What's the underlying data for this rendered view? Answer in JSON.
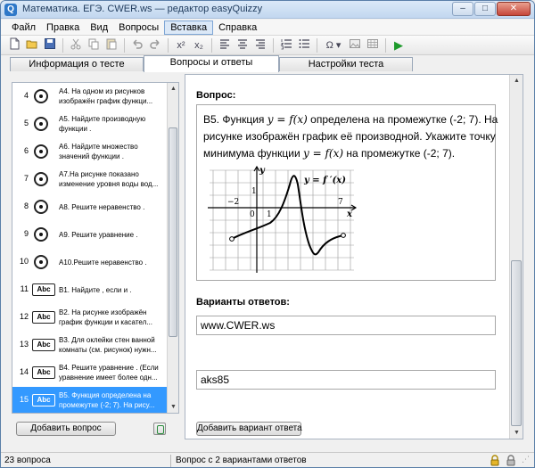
{
  "window": {
    "title": "Математика. ЕГЭ. CWER.ws — редактор easyQuizzy",
    "app_icon": "Q",
    "minimize": "–",
    "maximize": "□",
    "close": "✕"
  },
  "menu": [
    "Файл",
    "Правка",
    "Вид",
    "Вопросы",
    "Вставка",
    "Справка"
  ],
  "toolbar": {
    "icons": [
      "new-file-icon",
      "open-folder-icon",
      "save-icon",
      "cut-icon",
      "copy-icon",
      "paste-icon",
      "undo-icon",
      "redo-icon",
      "superscript-icon",
      "subscript-icon",
      "align-left-icon",
      "align-center-icon",
      "align-right-icon",
      "numbered-list-icon",
      "bullet-list-icon",
      "omega-symbol-icon",
      "image-icon",
      "table-icon",
      "play-icon"
    ],
    "superscript": "x²",
    "subscript": "x₂",
    "omega": "Ω ▾",
    "play": "▶"
  },
  "tabs": [
    "Информация о тесте",
    "Вопросы и ответы",
    "Настройки теста"
  ],
  "questions": [
    {
      "num": "4",
      "type": "radio",
      "text": "А4. На одном из рисунков\nизображён график функци..."
    },
    {
      "num": "5",
      "type": "radio",
      "text": "А5. Найдите производную\nфункции ."
    },
    {
      "num": "6",
      "type": "radio",
      "text": "А6. Найдите множество\nзначений функции ."
    },
    {
      "num": "7",
      "type": "radio",
      "text": "А7.На рисунке показано\nизменение уровня воды вод..."
    },
    {
      "num": "8",
      "type": "radio",
      "text": "А8. Решите неравенство ."
    },
    {
      "num": "9",
      "type": "radio",
      "text": "А9. Решите уравнение ."
    },
    {
      "num": "10",
      "type": "radio",
      "text": "А10.Решите неравенство ."
    },
    {
      "num": "11",
      "type": "abc",
      "text": "В1. Найдите , если и ."
    },
    {
      "num": "12",
      "type": "abc",
      "text": "В2. На рисунке изображён\nграфик функции и касател..."
    },
    {
      "num": "13",
      "type": "abc",
      "text": "В3. Для оклейки стен ванной\nкомнаты (см. рисунок) нужн..."
    },
    {
      "num": "14",
      "type": "abc",
      "text": "В4. Решите уравнение . (Если\nуравнение имеет более одн..."
    },
    {
      "num": "15",
      "type": "abc",
      "text": "В5. Функция определена на\nпромежутке (-2; 7). На рису...",
      "selected": true
    }
  ],
  "abc_label": "Abc",
  "add_question_button": "Добавить вопрос",
  "question_label": "Вопрос:",
  "question": {
    "line1_a": "В5. Функция ",
    "line1_fx": "y = f(x)",
    "line1_b": " определена на промежутке (-2; 7). На",
    "line2": "рисунке изображён график её производной. Укажите точку",
    "line3_a": "минимума функции ",
    "line3_fx": "y = f(x)",
    "line3_b": " на промежутке (-2; 7)."
  },
  "graph": {
    "y_axis": "y",
    "x_axis": "x",
    "label_neg2": "−2",
    "label_0": "0",
    "label_1x": "1",
    "label_1y": "1",
    "label_7": "7",
    "function_label": "y = f ′(x)"
  },
  "answers_label": "Варианты ответов:",
  "answers": [
    "www.CWER.ws",
    "aks85"
  ],
  "add_answer_button": "Добавить вариант ответа",
  "status": {
    "count": "23 вопроса",
    "info": "Вопрос с 2 вариантами ответов",
    "lock_icon": "lock-icon"
  }
}
